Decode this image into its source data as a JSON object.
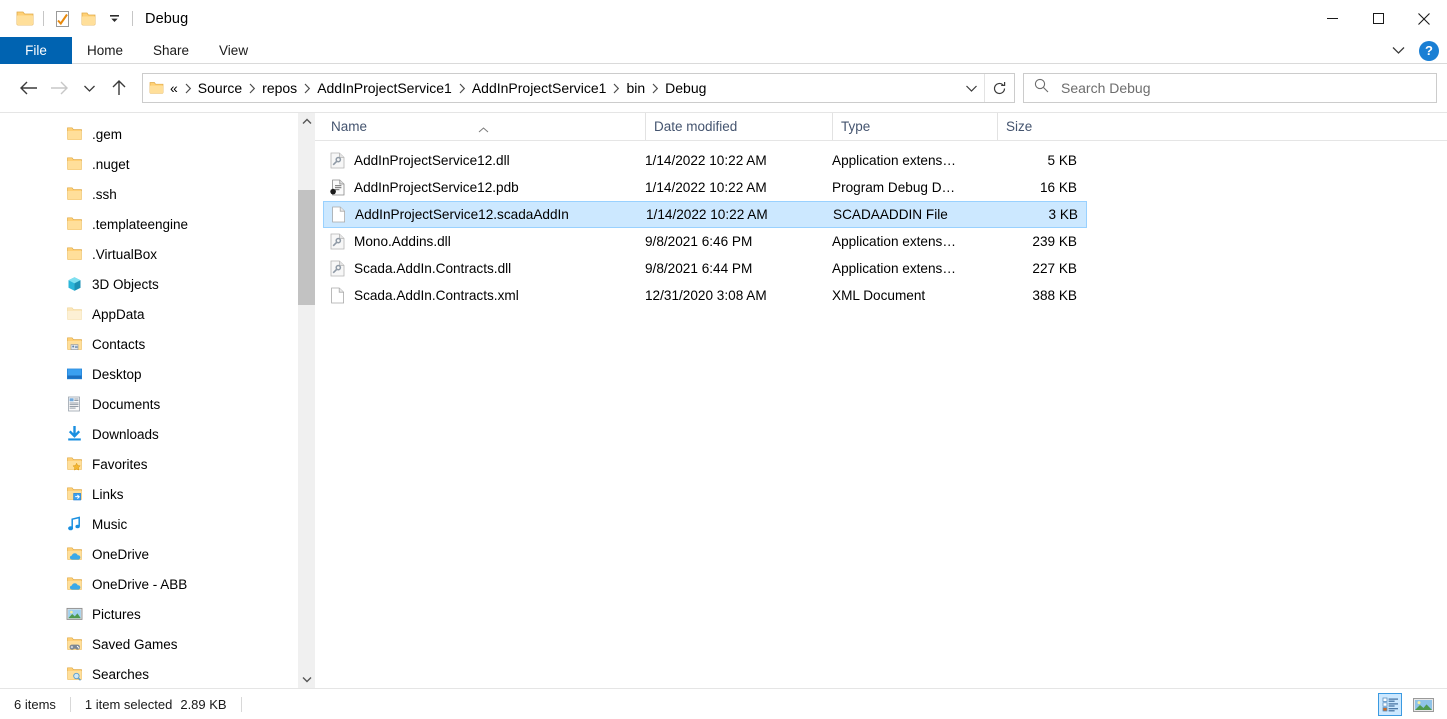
{
  "window": {
    "title": "Debug",
    "quick_access": [
      {
        "name": "folder-icon",
        "label": "Folder"
      },
      {
        "name": "properties-icon",
        "label": "Properties"
      },
      {
        "name": "new-folder-icon",
        "label": "New folder"
      },
      {
        "name": "customize-quick-access-icon",
        "label": "Customize Quick Access Toolbar"
      }
    ],
    "controls": {
      "minimize": "Minimize",
      "maximize": "Maximize",
      "close": "Close"
    }
  },
  "ribbon": {
    "tabs": [
      {
        "label": "File",
        "active": true
      },
      {
        "label": "Home",
        "active": false
      },
      {
        "label": "Share",
        "active": false
      },
      {
        "label": "View",
        "active": false
      }
    ],
    "expand_label": "Expand the Ribbon",
    "help_label": "?"
  },
  "navigation": {
    "back": "Back",
    "forward": "Forward",
    "recent": "Recent locations",
    "up": "Up",
    "refresh": "Refresh",
    "dropdown": "Previous locations"
  },
  "address": {
    "prefix": "«",
    "crumbs": [
      "Source",
      "repos",
      "AddInProjectService1",
      "AddInProjectService1",
      "bin",
      "Debug"
    ]
  },
  "search": {
    "placeholder": "Search Debug",
    "value": "",
    "icon": "search-icon"
  },
  "sidebar": {
    "items": [
      {
        "label": ".gem",
        "icon": "folder-icon"
      },
      {
        "label": ".nuget",
        "icon": "folder-icon"
      },
      {
        "label": ".ssh",
        "icon": "folder-icon"
      },
      {
        "label": ".templateengine",
        "icon": "folder-icon"
      },
      {
        "label": ".VirtualBox",
        "icon": "folder-icon"
      },
      {
        "label": "3D Objects",
        "icon": "3d-objects-icon"
      },
      {
        "label": "AppData",
        "icon": "folder-pale-icon"
      },
      {
        "label": "Contacts",
        "icon": "contacts-folder-icon"
      },
      {
        "label": "Desktop",
        "icon": "desktop-icon"
      },
      {
        "label": "Documents",
        "icon": "documents-icon"
      },
      {
        "label": "Downloads",
        "icon": "downloads-icon"
      },
      {
        "label": "Favorites",
        "icon": "favorites-folder-icon"
      },
      {
        "label": "Links",
        "icon": "links-folder-icon"
      },
      {
        "label": "Music",
        "icon": "music-icon"
      },
      {
        "label": "OneDrive",
        "icon": "onedrive-folder-icon"
      },
      {
        "label": "OneDrive - ABB",
        "icon": "onedrive-folder-icon"
      },
      {
        "label": "Pictures",
        "icon": "pictures-icon"
      },
      {
        "label": "Saved Games",
        "icon": "saved-games-folder-icon"
      },
      {
        "label": "Searches",
        "icon": "searches-folder-icon"
      }
    ],
    "scroll_up": "Scroll up",
    "scroll_down": "Scroll down"
  },
  "filelist": {
    "columns": [
      {
        "label": "Name",
        "key": "name",
        "sorted": true,
        "sort_dir": "asc"
      },
      {
        "label": "Date modified",
        "key": "date"
      },
      {
        "label": "Type",
        "key": "type"
      },
      {
        "label": "Size",
        "key": "size"
      }
    ],
    "rows": [
      {
        "name": "AddInProjectService12.dll",
        "date": "1/14/2022 10:22 AM",
        "type": "Application extens…",
        "size": "5 KB",
        "icon": "dll-file-icon",
        "selected": false
      },
      {
        "name": "AddInProjectService12.pdb",
        "date": "1/14/2022 10:22 AM",
        "type": "Program Debug D…",
        "size": "16 KB",
        "icon": "pdb-file-icon",
        "selected": false
      },
      {
        "name": "AddInProjectService12.scadaAddIn",
        "date": "1/14/2022 10:22 AM",
        "type": "SCADAADDIN File",
        "size": "3 KB",
        "icon": "generic-file-icon",
        "selected": true
      },
      {
        "name": "Mono.Addins.dll",
        "date": "9/8/2021 6:46 PM",
        "type": "Application extens…",
        "size": "239 KB",
        "icon": "dll-file-icon",
        "selected": false
      },
      {
        "name": "Scada.AddIn.Contracts.dll",
        "date": "9/8/2021 6:44 PM",
        "type": "Application extens…",
        "size": "227 KB",
        "icon": "dll-file-icon",
        "selected": false
      },
      {
        "name": "Scada.AddIn.Contracts.xml",
        "date": "12/31/2020 3:08 AM",
        "type": "XML Document",
        "size": "388 KB",
        "icon": "generic-file-icon",
        "selected": false
      }
    ]
  },
  "statusbar": {
    "item_count": "6 items",
    "selection": "1 item selected",
    "selection_size": "2.89 KB",
    "view_details": "Details view",
    "view_large_icons": "Large icons view"
  },
  "colors": {
    "accent": "#0063b1",
    "selection_fill": "#cce8ff",
    "selection_border": "#99d1ff",
    "header_text": "#44546f",
    "folder_yellow": "#ffd075",
    "help_blue": "#1a7fd4"
  }
}
